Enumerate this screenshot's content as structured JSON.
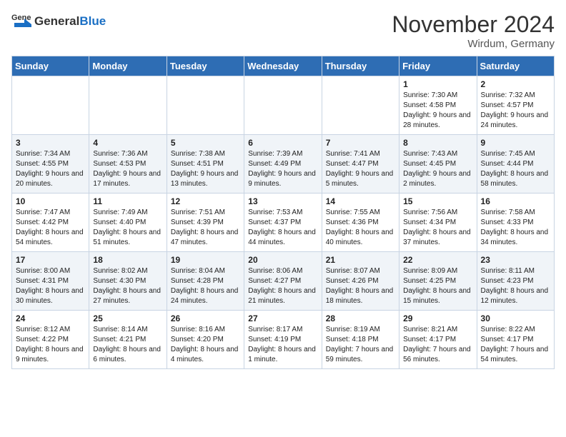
{
  "header": {
    "logo_general": "General",
    "logo_blue": "Blue",
    "month_title": "November 2024",
    "location": "Wirdum, Germany"
  },
  "days_of_week": [
    "Sunday",
    "Monday",
    "Tuesday",
    "Wednesday",
    "Thursday",
    "Friday",
    "Saturday"
  ],
  "weeks": [
    [
      {
        "day": "",
        "info": ""
      },
      {
        "day": "",
        "info": ""
      },
      {
        "day": "",
        "info": ""
      },
      {
        "day": "",
        "info": ""
      },
      {
        "day": "",
        "info": ""
      },
      {
        "day": "1",
        "info": "Sunrise: 7:30 AM\nSunset: 4:58 PM\nDaylight: 9 hours and 28 minutes."
      },
      {
        "day": "2",
        "info": "Sunrise: 7:32 AM\nSunset: 4:57 PM\nDaylight: 9 hours and 24 minutes."
      }
    ],
    [
      {
        "day": "3",
        "info": "Sunrise: 7:34 AM\nSunset: 4:55 PM\nDaylight: 9 hours and 20 minutes."
      },
      {
        "day": "4",
        "info": "Sunrise: 7:36 AM\nSunset: 4:53 PM\nDaylight: 9 hours and 17 minutes."
      },
      {
        "day": "5",
        "info": "Sunrise: 7:38 AM\nSunset: 4:51 PM\nDaylight: 9 hours and 13 minutes."
      },
      {
        "day": "6",
        "info": "Sunrise: 7:39 AM\nSunset: 4:49 PM\nDaylight: 9 hours and 9 minutes."
      },
      {
        "day": "7",
        "info": "Sunrise: 7:41 AM\nSunset: 4:47 PM\nDaylight: 9 hours and 5 minutes."
      },
      {
        "day": "8",
        "info": "Sunrise: 7:43 AM\nSunset: 4:45 PM\nDaylight: 9 hours and 2 minutes."
      },
      {
        "day": "9",
        "info": "Sunrise: 7:45 AM\nSunset: 4:44 PM\nDaylight: 8 hours and 58 minutes."
      }
    ],
    [
      {
        "day": "10",
        "info": "Sunrise: 7:47 AM\nSunset: 4:42 PM\nDaylight: 8 hours and 54 minutes."
      },
      {
        "day": "11",
        "info": "Sunrise: 7:49 AM\nSunset: 4:40 PM\nDaylight: 8 hours and 51 minutes."
      },
      {
        "day": "12",
        "info": "Sunrise: 7:51 AM\nSunset: 4:39 PM\nDaylight: 8 hours and 47 minutes."
      },
      {
        "day": "13",
        "info": "Sunrise: 7:53 AM\nSunset: 4:37 PM\nDaylight: 8 hours and 44 minutes."
      },
      {
        "day": "14",
        "info": "Sunrise: 7:55 AM\nSunset: 4:36 PM\nDaylight: 8 hours and 40 minutes."
      },
      {
        "day": "15",
        "info": "Sunrise: 7:56 AM\nSunset: 4:34 PM\nDaylight: 8 hours and 37 minutes."
      },
      {
        "day": "16",
        "info": "Sunrise: 7:58 AM\nSunset: 4:33 PM\nDaylight: 8 hours and 34 minutes."
      }
    ],
    [
      {
        "day": "17",
        "info": "Sunrise: 8:00 AM\nSunset: 4:31 PM\nDaylight: 8 hours and 30 minutes."
      },
      {
        "day": "18",
        "info": "Sunrise: 8:02 AM\nSunset: 4:30 PM\nDaylight: 8 hours and 27 minutes."
      },
      {
        "day": "19",
        "info": "Sunrise: 8:04 AM\nSunset: 4:28 PM\nDaylight: 8 hours and 24 minutes."
      },
      {
        "day": "20",
        "info": "Sunrise: 8:06 AM\nSunset: 4:27 PM\nDaylight: 8 hours and 21 minutes."
      },
      {
        "day": "21",
        "info": "Sunrise: 8:07 AM\nSunset: 4:26 PM\nDaylight: 8 hours and 18 minutes."
      },
      {
        "day": "22",
        "info": "Sunrise: 8:09 AM\nSunset: 4:25 PM\nDaylight: 8 hours and 15 minutes."
      },
      {
        "day": "23",
        "info": "Sunrise: 8:11 AM\nSunset: 4:23 PM\nDaylight: 8 hours and 12 minutes."
      }
    ],
    [
      {
        "day": "24",
        "info": "Sunrise: 8:12 AM\nSunset: 4:22 PM\nDaylight: 8 hours and 9 minutes."
      },
      {
        "day": "25",
        "info": "Sunrise: 8:14 AM\nSunset: 4:21 PM\nDaylight: 8 hours and 6 minutes."
      },
      {
        "day": "26",
        "info": "Sunrise: 8:16 AM\nSunset: 4:20 PM\nDaylight: 8 hours and 4 minutes."
      },
      {
        "day": "27",
        "info": "Sunrise: 8:17 AM\nSunset: 4:19 PM\nDaylight: 8 hours and 1 minute."
      },
      {
        "day": "28",
        "info": "Sunrise: 8:19 AM\nSunset: 4:18 PM\nDaylight: 7 hours and 59 minutes."
      },
      {
        "day": "29",
        "info": "Sunrise: 8:21 AM\nSunset: 4:17 PM\nDaylight: 7 hours and 56 minutes."
      },
      {
        "day": "30",
        "info": "Sunrise: 8:22 AM\nSunset: 4:17 PM\nDaylight: 7 hours and 54 minutes."
      }
    ]
  ]
}
